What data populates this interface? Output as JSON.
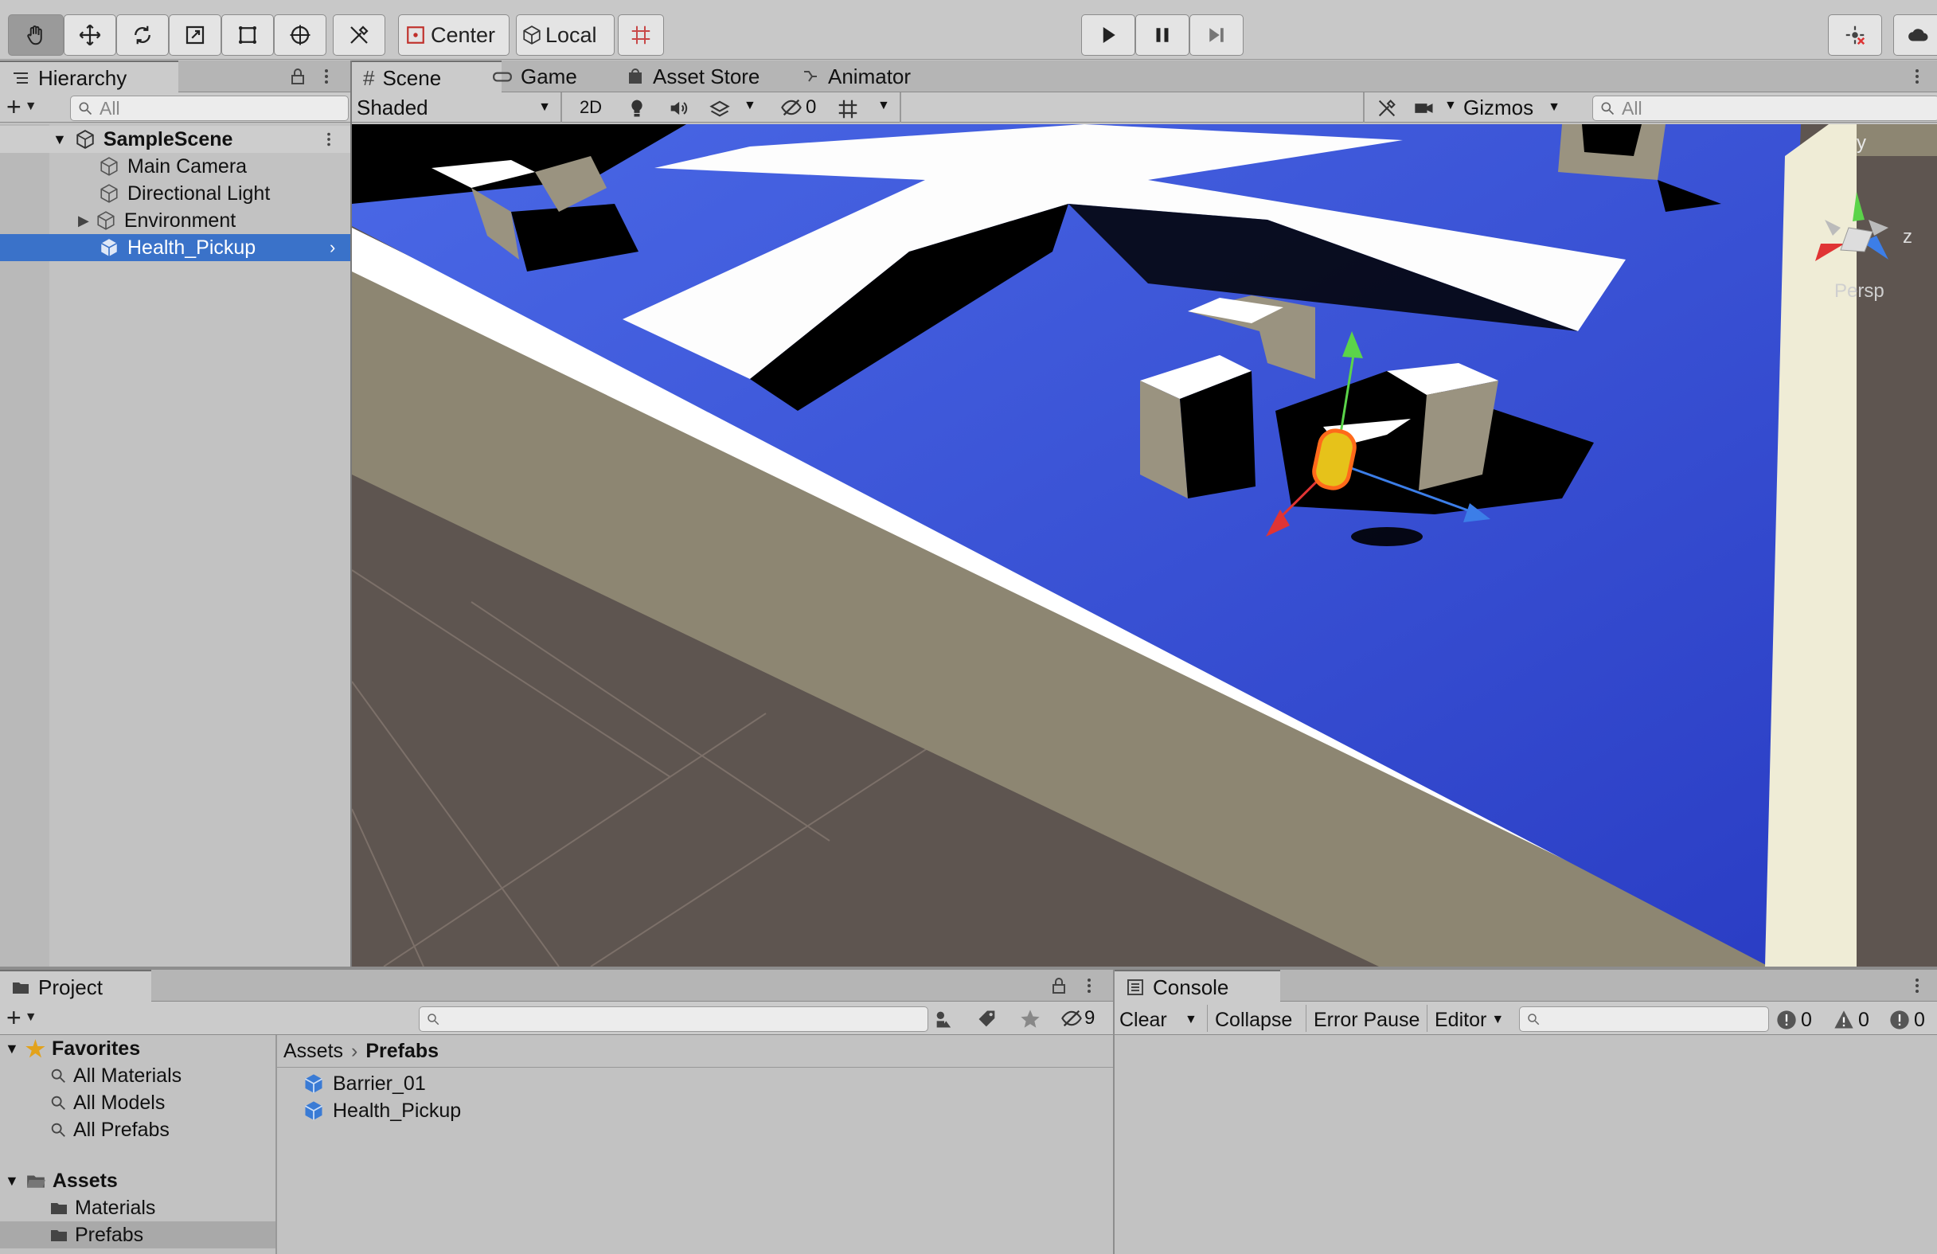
{
  "toolbar": {
    "center_label": "Center",
    "local_label": "Local"
  },
  "hierarchy": {
    "tab_label": "Hierarchy",
    "search_placeholder": "All",
    "scene_name": "SampleScene",
    "items": [
      {
        "label": "Main Camera"
      },
      {
        "label": "Directional Light"
      },
      {
        "label": "Environment"
      },
      {
        "label": "Health_Pickup"
      }
    ]
  },
  "scene_view": {
    "tabs": [
      {
        "label": "Scene"
      },
      {
        "label": "Game"
      },
      {
        "label": "Asset Store"
      },
      {
        "label": "Animator"
      }
    ],
    "shading_mode": "Shaded",
    "mode_2d": "2D",
    "hidden_count": "0",
    "gizmos_label": "Gizmos",
    "search_placeholder": "All",
    "axis_y": "y",
    "axis_z": "z",
    "projection": "Persp"
  },
  "project": {
    "tab_label": "Project",
    "hidden_count": "9",
    "favorites_label": "Favorites",
    "favorites": [
      {
        "label": "All Materials"
      },
      {
        "label": "All Models"
      },
      {
        "label": "All Prefabs"
      }
    ],
    "assets_label": "Assets",
    "asset_folders": [
      {
        "label": "Materials"
      },
      {
        "label": "Prefabs"
      }
    ],
    "breadcrumb_root": "Assets",
    "breadcrumb_current": "Prefabs",
    "files": [
      {
        "label": "Barrier_01"
      },
      {
        "label": "Health_Pickup"
      }
    ]
  },
  "console": {
    "tab_label": "Console",
    "clear_label": "Clear",
    "collapse_label": "Collapse",
    "error_pause_label": "Error Pause",
    "editor_label": "Editor",
    "log_count": "0",
    "warning_count": "0",
    "error_count": "0"
  },
  "colors": {
    "selection": "#3a72c9",
    "ground_blue": "#2e46c9",
    "wall": "#8d8672",
    "grid_floor": "#5e5550"
  }
}
